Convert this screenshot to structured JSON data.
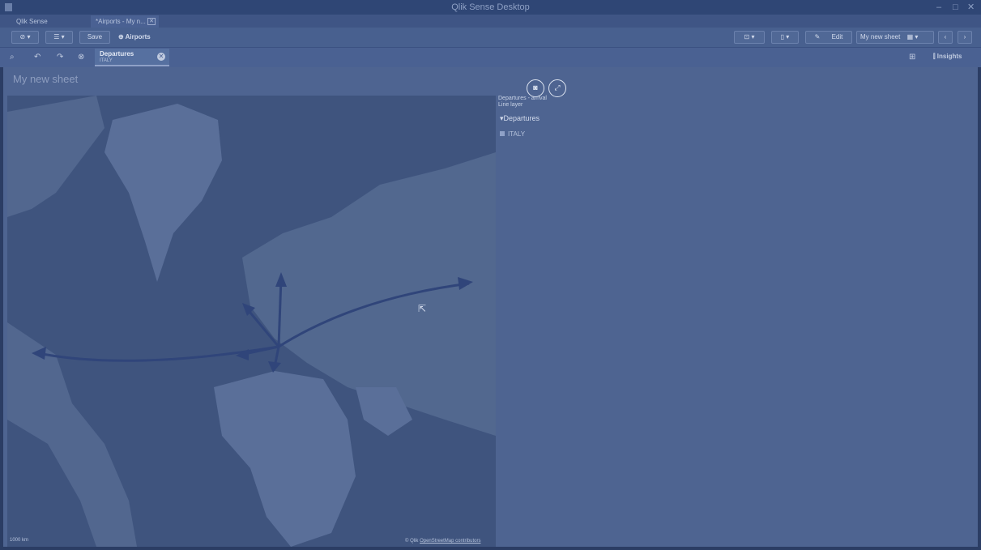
{
  "window": {
    "title": "Qlik Sense Desktop"
  },
  "tabs": [
    {
      "label": "Qlik Sense Desktop hub"
    },
    {
      "label": "*Airports - My n..."
    }
  ],
  "toolbar": {
    "save_label": "Save",
    "app_name": "Airports",
    "edit_label": "Edit",
    "sheet_selector": "My new sheet"
  },
  "selections": {
    "field": "Departures",
    "value": "ITALY",
    "insights_label": "Insights"
  },
  "sheet": {
    "title": "My new sheet"
  },
  "map": {
    "legend_title_line1": "Departures - arrival",
    "legend_title_line2": "Line layer",
    "legend_header": "Departures",
    "legend_item": "ITALY",
    "scale_label": "1000 km",
    "attribution_prefix": "© Qlik",
    "attribution_link": "OpenStreetMap contributors",
    "colors": {
      "land": "#5a6f99",
      "water": "#3f547e",
      "arrow": "#30457a"
    }
  }
}
